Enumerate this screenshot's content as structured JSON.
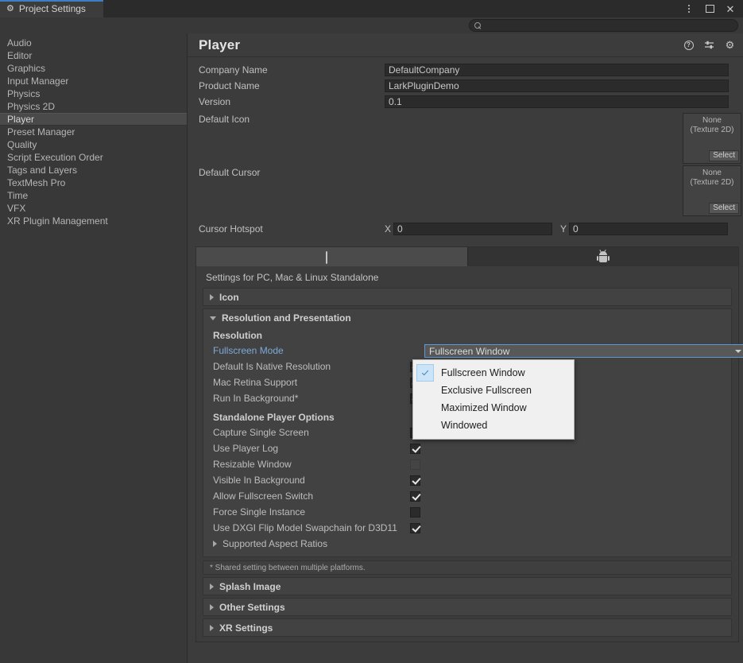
{
  "window": {
    "tab_label": "Project Settings",
    "tab_icon": "gear-icon",
    "controls": {
      "menu": "kebab-menu-icon",
      "maximize": "maximize-icon",
      "close": "close-icon"
    },
    "accent_color": "#3d7ec4"
  },
  "search": {
    "value": "",
    "placeholder": "",
    "icon": "search-icon"
  },
  "sidebar": {
    "items": [
      {
        "label": "Audio",
        "selected": false
      },
      {
        "label": "Editor",
        "selected": false
      },
      {
        "label": "Graphics",
        "selected": false
      },
      {
        "label": "Input Manager",
        "selected": false
      },
      {
        "label": "Physics",
        "selected": false
      },
      {
        "label": "Physics 2D",
        "selected": false
      },
      {
        "label": "Player",
        "selected": true
      },
      {
        "label": "Preset Manager",
        "selected": false
      },
      {
        "label": "Quality",
        "selected": false
      },
      {
        "label": "Script Execution Order",
        "selected": false
      },
      {
        "label": "Tags and Layers",
        "selected": false
      },
      {
        "label": "TextMesh Pro",
        "selected": false
      },
      {
        "label": "Time",
        "selected": false
      },
      {
        "label": "VFX",
        "selected": false
      },
      {
        "label": "XR Plugin Management",
        "selected": false
      }
    ]
  },
  "header": {
    "title": "Player",
    "icons": [
      {
        "name": "help-icon",
        "glyph": "?"
      },
      {
        "name": "preset-icon",
        "glyph": ""
      },
      {
        "name": "settings-gear-icon",
        "glyph": "⚙"
      }
    ]
  },
  "identification": {
    "company_name": {
      "label": "Company Name",
      "value": "DefaultCompany"
    },
    "product_name": {
      "label": "Product Name",
      "value": "LarkPluginDemo"
    },
    "version": {
      "label": "Version",
      "value": "0.1"
    },
    "default_icon": {
      "label": "Default Icon",
      "value": "None",
      "type": "(Texture 2D)",
      "select_label": "Select"
    },
    "default_cursor": {
      "label": "Default Cursor",
      "value": "None",
      "type": "(Texture 2D)",
      "select_label": "Select"
    },
    "cursor_hotspot": {
      "label": "Cursor Hotspot",
      "x_label": "X",
      "x_value": "0",
      "y_label": "Y",
      "y_value": "0"
    }
  },
  "platform_tabs": [
    {
      "name": "standalone",
      "icon": "monitor-icon",
      "active": true
    },
    {
      "name": "android",
      "icon": "android-robot-icon",
      "active": false
    }
  ],
  "platform_caption": "Settings for PC, Mac & Linux Standalone",
  "sections": {
    "icon": {
      "label": "Icon",
      "expanded": false
    },
    "resolution": {
      "label": "Resolution and Presentation",
      "expanded": true,
      "resolution_header": "Resolution",
      "fullscreen_mode": {
        "label": "Fullscreen Mode",
        "value": "Fullscreen Window",
        "options": [
          {
            "label": "Fullscreen Window",
            "selected": true
          },
          {
            "label": "Exclusive Fullscreen",
            "selected": false
          },
          {
            "label": "Maximized Window",
            "selected": false
          },
          {
            "label": "Windowed",
            "selected": false
          }
        ]
      },
      "rows": [
        {
          "label": "Default Is Native Resolution",
          "checked": true,
          "hidden_by_popup": true
        },
        {
          "label": "Mac Retina Support",
          "checked": true,
          "hidden_by_popup": true
        },
        {
          "label": "Run In Background*",
          "checked": true,
          "hidden_by_popup": true
        }
      ],
      "standalone_header": "Standalone Player Options",
      "standalone_rows": [
        {
          "label": "Capture Single Screen",
          "checked": false
        },
        {
          "label": "Use Player Log",
          "checked": true
        },
        {
          "label": "Resizable Window",
          "checked": false
        },
        {
          "label": "Visible In Background",
          "checked": true
        },
        {
          "label": "Allow Fullscreen Switch",
          "checked": true
        },
        {
          "label": "Force Single Instance",
          "checked": false
        },
        {
          "label": "Use DXGI Flip Model Swapchain for D3D11",
          "checked": true
        }
      ],
      "aspect_ratios": {
        "label": "Supported Aspect Ratios",
        "expanded": false
      }
    },
    "note": "* Shared setting between multiple platforms.",
    "splash": {
      "label": "Splash Image",
      "expanded": false
    },
    "other": {
      "label": "Other Settings",
      "expanded": false
    },
    "xr": {
      "label": "XR Settings",
      "expanded": false
    }
  }
}
